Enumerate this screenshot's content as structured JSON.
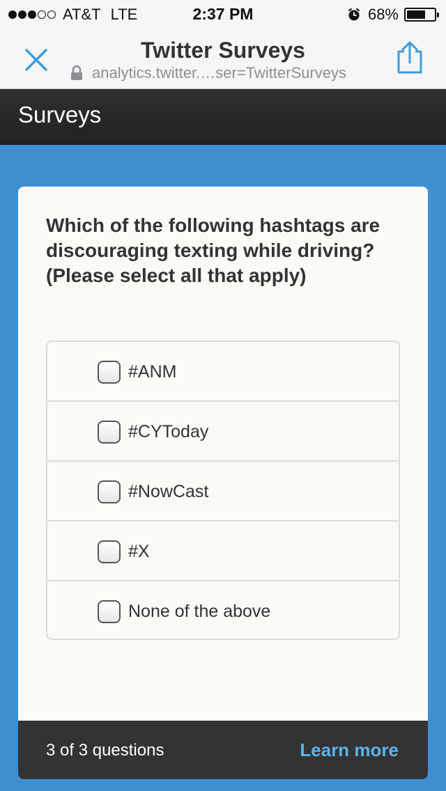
{
  "status_bar": {
    "carrier": "AT&T",
    "network": "LTE",
    "time": "2:37 PM",
    "battery": "68%",
    "battery_level": 0.68,
    "signal_bars_filled": 3,
    "signal_bars_total": 5
  },
  "nav": {
    "title": "Twitter Surveys",
    "url": "analytics.twitter.…ser=TwitterSurveys",
    "close_icon": "close-icon",
    "share_icon": "share-icon",
    "accent_color": "#3d9bdc"
  },
  "header": {
    "title": "Surveys"
  },
  "survey": {
    "question": "Which of the following hashtags are discouraging texting while driving? (Please select all that apply)",
    "options": [
      {
        "label": "#ANM",
        "checked": false
      },
      {
        "label": "#CYToday",
        "checked": false
      },
      {
        "label": "#NowCast",
        "checked": false
      },
      {
        "label": "#X",
        "checked": false
      },
      {
        "label": "None of the above",
        "checked": false
      }
    ]
  },
  "footer": {
    "progress": "3 of 3 questions",
    "learn_more": "Learn more",
    "link_color": "#5ab4f0"
  },
  "colors": {
    "background": "#3f8fd0",
    "header_bg": "#2a2a2a",
    "card_bg": "#fbfaf7"
  }
}
